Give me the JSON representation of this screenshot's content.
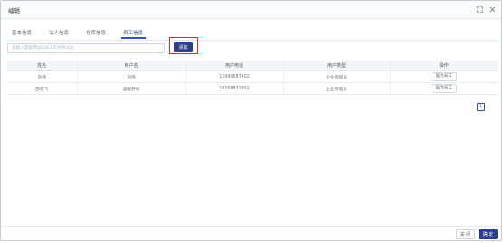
{
  "dialog": {
    "title": "编辑"
  },
  "tabs": [
    {
      "label": "基本信息",
      "active": false
    },
    {
      "label": "法人信息",
      "active": false
    },
    {
      "label": "仓库信息",
      "active": false
    },
    {
      "label": "员工信息",
      "active": true
    }
  ],
  "search": {
    "placeholder": "请输入需要添加的员工的手机号码",
    "value": ""
  },
  "add_button": {
    "label": "添加"
  },
  "table": {
    "columns": [
      "姓名",
      "用户名",
      "用户电话",
      "用户类型",
      "操作"
    ],
    "rows": [
      {
        "name": "刘伟",
        "username": "刘伟",
        "phone": "15990587402",
        "type": "企业管理员",
        "action": "设为员工"
      },
      {
        "name": "邵定飞",
        "username": "温暖梦想",
        "phone": "18268833892",
        "type": "企业管理员",
        "action": "设为员工"
      }
    ]
  },
  "pagination": {
    "current": "1",
    "prev": "‹",
    "next": "›"
  },
  "footer": {
    "close_label": "关 闭",
    "ok_label": "确 定"
  },
  "icons": {
    "expand": "expand-icon",
    "close": "close-icon"
  },
  "colors": {
    "accent": "#2c3f8f",
    "highlight": "#e02a2a"
  }
}
